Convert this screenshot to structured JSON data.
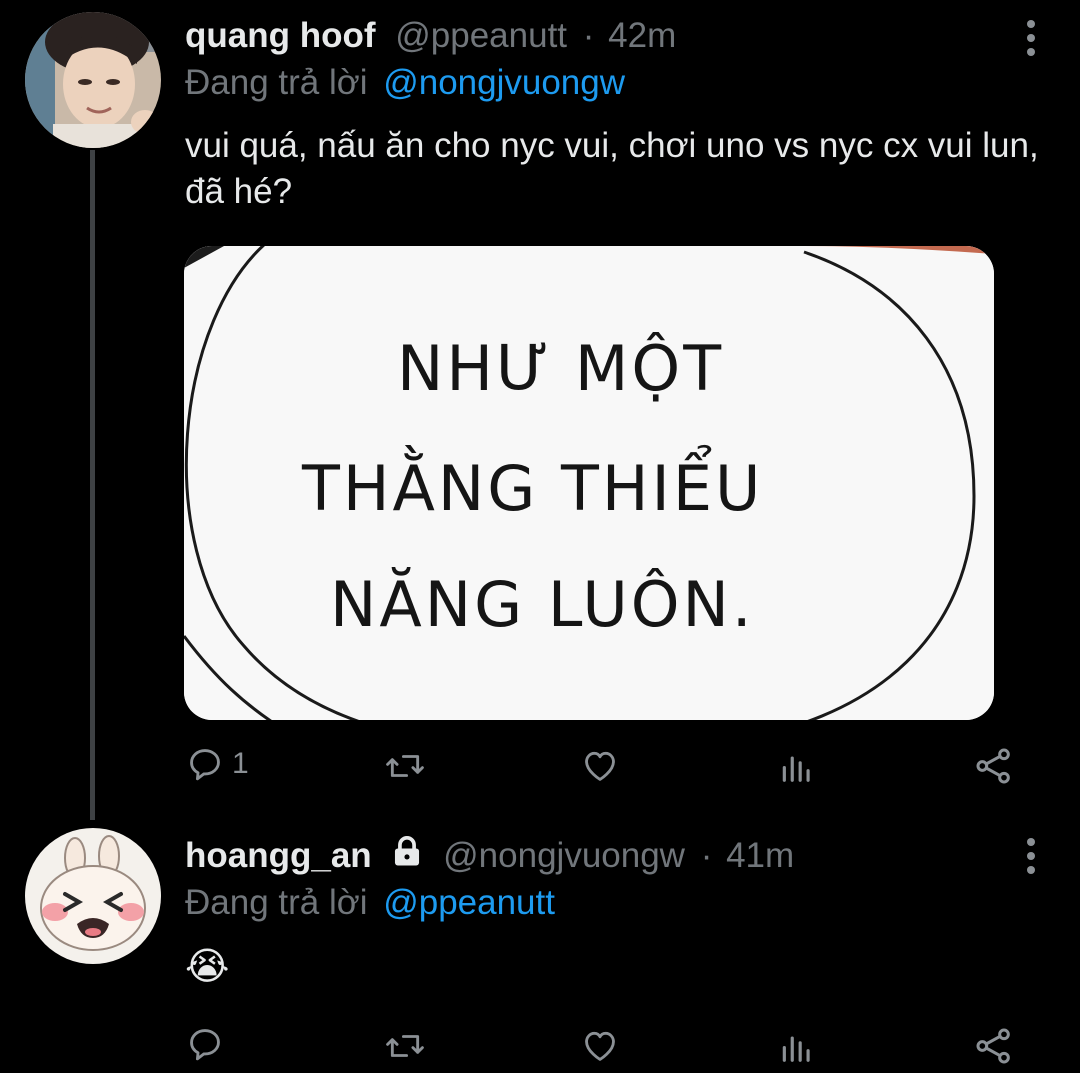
{
  "tweets": [
    {
      "display_name": "quang hoof",
      "handle": "@ppeanutt",
      "separator": "·",
      "time": "42m",
      "reply_prefix": "Đang trả lời",
      "reply_to": "@nongjvuongw",
      "text": "vui quá, nấu ăn cho nyc vui, chơi uno vs nyc cx vui lun, đã hé?",
      "media": {
        "lines": [
          "NHƯ MỘT",
          "THẰNG THIỂU",
          "NĂNG LUÔN."
        ]
      },
      "actions": {
        "reply_count": "1",
        "icons": [
          "reply-icon",
          "retweet-icon",
          "like-icon",
          "analytics-icon",
          "share-icon"
        ]
      }
    },
    {
      "display_name": "hoangg_an",
      "handle": "@nongjvuongw",
      "separator": "·",
      "time": "41m",
      "reply_prefix": "Đang trả lời",
      "reply_to": "@ppeanutt",
      "text": "😭",
      "protected": true,
      "actions": {
        "reply_count": "",
        "icons": [
          "reply-icon",
          "retweet-icon",
          "like-icon",
          "analytics-icon",
          "share-icon"
        ]
      }
    }
  ],
  "colors": {
    "background": "#000000",
    "text": "#e7e9ea",
    "muted": "#71767b",
    "link": "#1d9bf0",
    "thread_line": "#3e4144"
  }
}
